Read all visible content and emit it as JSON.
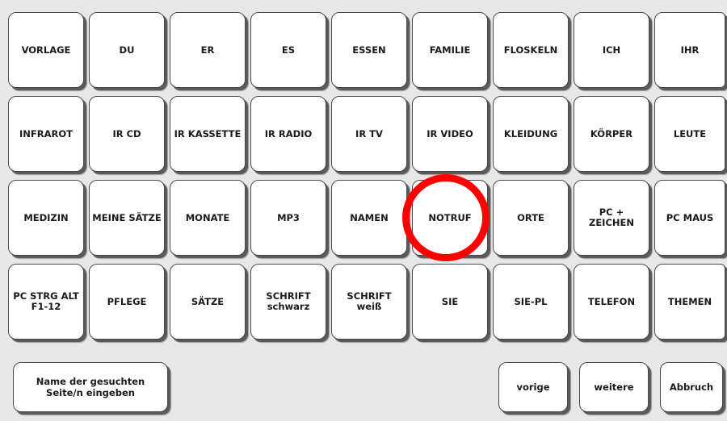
{
  "colors": {
    "background": "#e8e8e8",
    "key_face": "#ffffff",
    "key_border": "#4a4a4a",
    "highlight_ring": "#ff0000"
  },
  "grid": {
    "rows": [
      [
        "VORLAGE",
        "DU",
        "ER",
        "ES",
        "ESSEN",
        "FAMILIE",
        "FLOSKELN",
        "ICH",
        "IHR"
      ],
      [
        "INFRAROT",
        "IR CD",
        "IR KASSETTE",
        "IR RADIO",
        "IR TV",
        "IR VIDEO",
        "KLEIDUNG",
        "KÖRPER",
        "LEUTE"
      ],
      [
        "MEDIZIN",
        "MEINE SÄTZE",
        "MONATE",
        "MP3",
        "NAMEN",
        "NOTRUF",
        "ORTE",
        "PC +\nZEICHEN",
        "PC MAUS"
      ],
      [
        "PC STRG ALT\nF1-12",
        "PFLEGE",
        "SÄTZE",
        "SCHRIFT\nschwarz",
        "SCHRIFT\nweiß",
        "SIE",
        "SIE-PL",
        "TELEFON",
        "THEMEN"
      ]
    ],
    "highlighted": "NOTRUF"
  },
  "bottom_bar": {
    "search_label": "Name der gesuchten\nSeite/n eingeben",
    "prev_label": "vorige",
    "next_label": "weitere",
    "cancel_label": "Abbruch"
  }
}
